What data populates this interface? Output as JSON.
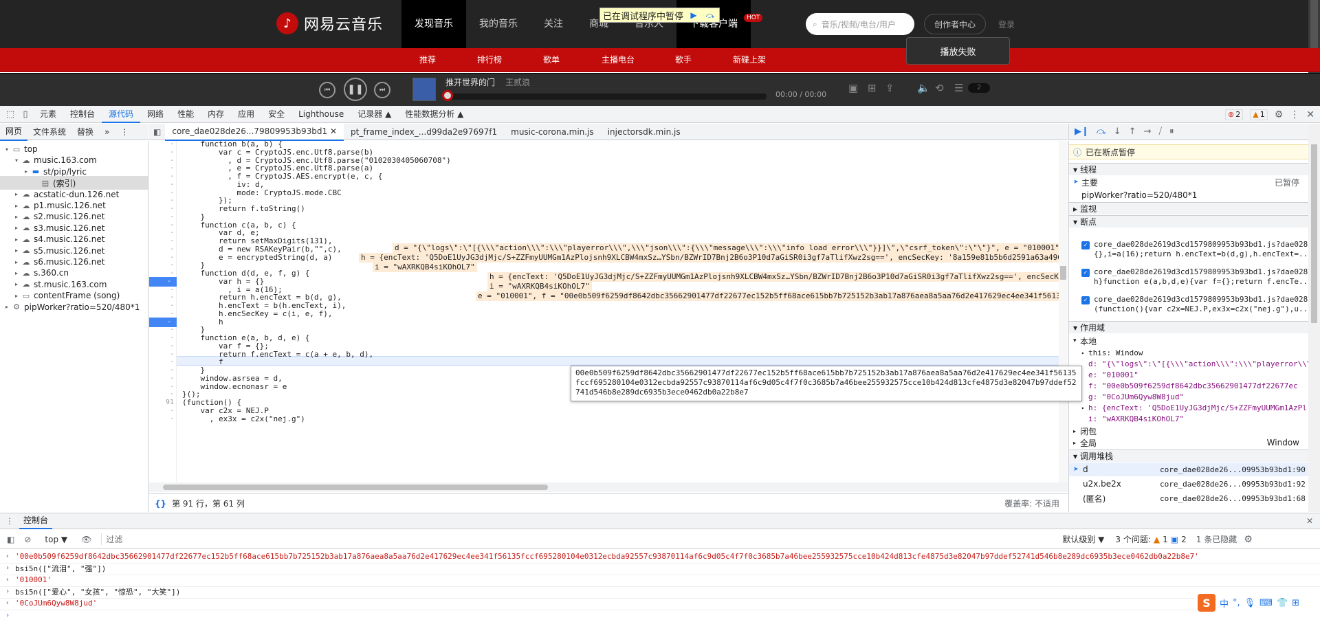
{
  "site": {
    "logo_text": "网易云音乐",
    "nav": [
      "发现音乐",
      "我的音乐",
      "关注",
      "商城",
      "音乐人",
      "下载客户端"
    ],
    "hot_badge": "HOT",
    "debug_paused_label": "已在调试程序中暂停",
    "search_placeholder": "音乐/视频/电台/用户",
    "creator_btn": "创作者中心",
    "login": "登录",
    "sub_nav": [
      "推荐",
      "排行榜",
      "歌单",
      "主播电台",
      "歌手",
      "新碟上架"
    ],
    "play_fail": "播放失败"
  },
  "player": {
    "song_title": "推开世界的门",
    "artist": "王贰浪",
    "time_current": "00:00",
    "time_total": "/ 00:00",
    "playlist_count": "2",
    "progress": 0
  },
  "devtools": {
    "tabs": [
      "元素",
      "控制台",
      "源代码",
      "网络",
      "性能",
      "内存",
      "应用",
      "安全",
      "Lighthouse",
      "记录器 ▲",
      "性能数据分析 ▲"
    ],
    "error_count": "2",
    "warn_count": "1",
    "nav_tabs": [
      "网页",
      "文件系统",
      "替换"
    ],
    "file_tabs": [
      "core_dae028de26...79809953b93bd1",
      "pt_frame_index_...d99da2e97697f1",
      "music-corona.min.js",
      "injectorsdk.min.js"
    ],
    "tree": [
      {
        "label": "top",
        "depth": 0,
        "icon": "frame"
      },
      {
        "label": "music.163.com",
        "depth": 1,
        "icon": "cloud"
      },
      {
        "label": "st/pip/lyric",
        "depth": 2,
        "icon": "folder"
      },
      {
        "label": "(索引)",
        "depth": 3,
        "icon": "file"
      },
      {
        "label": "acstatic-dun.126.net",
        "depth": 1,
        "icon": "cloud"
      },
      {
        "label": "p1.music.126.net",
        "depth": 1,
        "icon": "cloud"
      },
      {
        "label": "s2.music.126.net",
        "depth": 1,
        "icon": "cloud"
      },
      {
        "label": "s3.music.126.net",
        "depth": 1,
        "icon": "cloud"
      },
      {
        "label": "s4.music.126.net",
        "depth": 1,
        "icon": "cloud"
      },
      {
        "label": "s5.music.126.net",
        "depth": 1,
        "icon": "cloud"
      },
      {
        "label": "s6.music.126.net",
        "depth": 1,
        "icon": "cloud"
      },
      {
        "label": "s.360.cn",
        "depth": 1,
        "icon": "cloud"
      },
      {
        "label": "st.music.163.com",
        "depth": 1,
        "icon": "cloud"
      },
      {
        "label": "contentFrame (song)",
        "depth": 1,
        "icon": "frame"
      },
      {
        "label": "pipWorker?ratio=520/480*1",
        "depth": 0,
        "icon": "gear"
      }
    ],
    "status": {
      "position": "第 91 行，第 61 列",
      "coverage": "覆盖率: 不适用"
    },
    "tooltip": "00e0b509f6259df8642dbc35662901477df22677ec152b5ff68ace615bb7b725152b3ab17a876aea8a5aa76d2e417629ec4ee341f56135fccf695280104e0312ecbda92557c93870114af6c9d05c4f7f0c3685b7a46bee255932575cce10b424d813cfe4875d3e82047b97ddef52741d546b8e289dc6935b3ece0462db0a22b8e7"
  },
  "code_lines": [
    {
      "t": "    function b(a, b) {"
    },
    {
      "t": "        var c = CryptoJS.enc.Utf8.parse(b)"
    },
    {
      "t": "          , d = CryptoJS.enc.Utf8.parse(\"0102030405060708\")"
    },
    {
      "t": "          , e = CryptoJS.enc.Utf8.parse(a)"
    },
    {
      "t": "          , f = CryptoJS.AES.encrypt(e, c, {"
    },
    {
      "t": "            iv: d,"
    },
    {
      "t": "            mode: CryptoJS.mode.CBC"
    },
    {
      "t": "        });"
    },
    {
      "t": "        return f.toString()"
    },
    {
      "t": "    }"
    },
    {
      "t": "    function c(a, b, c) {"
    },
    {
      "t": "        var d, e;"
    },
    {
      "t": "        return setMaxDigits(131),"
    },
    {
      "t": "        d = new RSAKeyPair(b,\"\",c),"
    },
    {
      "t": "        e = encryptedString(d, a)"
    },
    {
      "t": "    }"
    },
    {
      "t": "    function d(d, e, f, g) {"
    },
    {
      "t": "        var h = {}"
    },
    {
      "t": "          , i = a(16);"
    },
    {
      "t": "        return h.encText = b(d, g),"
    },
    {
      "t": "        h.encText = b(h.encText, i),"
    },
    {
      "t": "        h.encSecKey = c(i, e, f),"
    },
    {
      "t": "        h"
    },
    {
      "t": "    }"
    },
    {
      "t": "    function e(a, b, d, e) {"
    },
    {
      "t": "        var f = {};"
    },
    {
      "t": "        return f.encText = c(a + e, b, d),"
    },
    {
      "t": "        f"
    },
    {
      "t": "    }"
    },
    {
      "t": "    window.asrsea = d,"
    },
    {
      "t": "    window.ecnonasr = e"
    },
    {
      "t": "}();"
    },
    {
      "t": "(function() {"
    },
    {
      "t": "    var c2x = NEJ.P"
    },
    {
      "t": "      , ex3x = c2x(\"nej.g\")"
    }
  ],
  "inline_values": {
    "l16": "d = \"{\\\"logs\\\":\\\"[{\\\\\\\"action\\\\\\\":\\\\\\\"playerror\\\\\\\",\\\\\\\"json\\\\\\\":{\\\\\\\"message\\\\\\\":\\\\\\\"info load error\\\\\\\"}}]\\\",\\\"csrf_token\\\":\\\"\\\"}\", e = \"010001\", f = \"00e0b509f6259",
    "l17": "h = {encText: 'Q5DoE1UyJG3djMjc/S+ZZFmyUUMGm1AzPlojsnh9XLCBW4mxSz…YSbn/BZWrID7Bnj2B6o3P10d7aGiSR0i3gf7aTlifXwz2sg==', encSecKey: '8a159e81b5b6d2591a63a49654180287fa977a7e4e8336",
    "l18": "i = \"wAXRKQB4siKOhOL7\"",
    "l19": "h = {encText: 'Q5DoE1UyJG3djMjc/S+ZZFmyUUMGm1AzPlojsnh9XLCBW4mxSz…YSbn/BZWrID7Bnj2B6o3P10d7aGiSR0i3gf7aTlifXwz2sg==', encSecKey: '8a159e81b5b6d2591a63a49654180",
    "l20": "i = \"wAXRKQB4siKOhOL7\"",
    "l21": "e = \"010001\", f = \"00e0b509f6259df8642dbc35662901477df22677ec152b5ff68ace615bb7b725152b3ab17a876aea8a5aa76d2e417629ec4ee341f56135fccf695280104e0312ecbda92557c938"
  },
  "right": {
    "paused": "已在断点暂停",
    "threads": "线程",
    "main": "主要",
    "main_state": "已暂停",
    "worker": "pipWorker?ratio=520/480*1",
    "watch": "监视",
    "breakpoints": "断点",
    "bp": [
      {
        "file": "core_dae028de2619d3cd1579809953b93bd1.js?dae028...",
        "code": "{},i=a(16);return h.encText=b(d,g),h.encText=..."
      },
      {
        "file": "core_dae028de2619d3cd1579809953b93bd1.js?dae028...",
        "code": "h}function e(a,b,d,e){var f={};return f.encTe..."
      },
      {
        "file": "core_dae028de2619d3cd1579809953b93bd1.js?dae028...",
        "code": "(function(){var c2x=NEJ.P,ex3x=c2x(\"nej.g\"),u..."
      }
    ],
    "scope": "作用域",
    "local": "本地",
    "this_val": "this: Window",
    "d_val": "d: \"{\\\"logs\\\":\\\"[{\\\\\\\"action\\\\\\\":\\\\\\\"playerror\\\\\\\"",
    "e_val": "e: \"010001\"",
    "f_val": "f: \"00e0b509f6259df8642dbc35662901477df22677ec",
    "g_val": "g: \"0CoJUm6Qyw8W8jud\"",
    "h_val": "h: {encText: 'Q5DoE1UyJG3djMjc/S+ZZFmyUUMGm1AzPl",
    "i_val": "i: \"wAXRKQB4siKOhOL7\"",
    "closure": "闭包",
    "global": "全局",
    "global_val": "Window",
    "callstack": "调用堆栈",
    "stack": [
      {
        "fn": "d",
        "loc": "core_dae028de26...09953b93bd1:90"
      },
      {
        "fn": "u2x.be2x",
        "loc": "core_dae028de26...09953b93bd1:92"
      },
      {
        "fn": "(匿名)",
        "loc": "core_dae028de26...09953b93bd1:68"
      }
    ]
  },
  "console": {
    "title": "控制台",
    "context": "top ▼",
    "filter_placeholder": "过滤",
    "levels": "默认级别 ▼",
    "issues": "3 个问题:",
    "issue_warn": "1",
    "issue_info": "2",
    "hidden": "1 条已隐藏",
    "lines": [
      {
        "kind": "out",
        "text": "'00e0b509f6259df8642dbc35662901477df22677ec152b5ff68ace615bb7b725152b3ab17a876aea8a5aa76d2e417629ec4ee341f56135fccf695280104e0312ecbda92557c93870114af6c9d05c4f7f0c3685b7a46bee255932575cce10b424d813cfe4875d3e82047b97ddef52741d546b8e289dc6935b3ece0462db0a22b8e7'"
      },
      {
        "kind": "in",
        "text": "bsi5n([\"流泪\", \"强\"])"
      },
      {
        "kind": "out",
        "text": "'010001'"
      },
      {
        "kind": "in",
        "text": "bsi5n([\"爱心\", \"女孩\", \"惊恐\", \"大笑\"])"
      },
      {
        "kind": "out",
        "text": "'0CoJUm6Qyw8W8jud'"
      }
    ]
  },
  "ime": {
    "logo": "S",
    "mode": "中"
  },
  "colors": {
    "brand": "#c20c0c",
    "accent": "#1a73e8"
  }
}
